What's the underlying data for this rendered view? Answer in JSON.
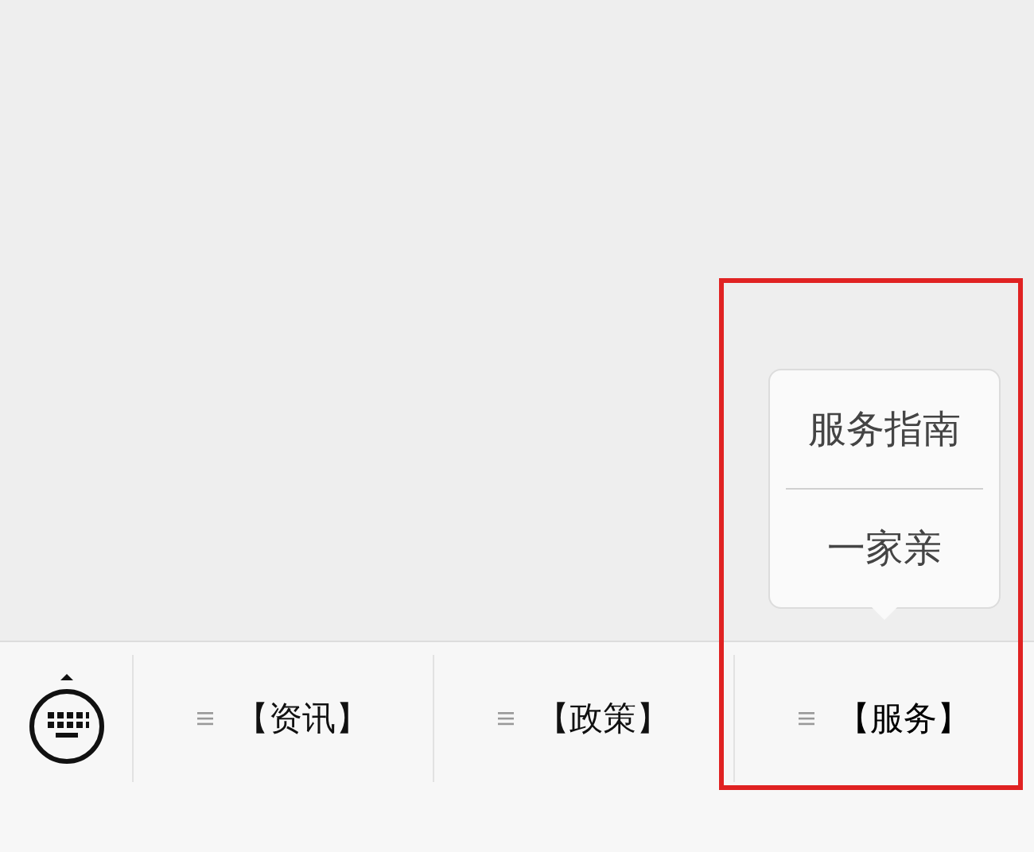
{
  "menus": [
    {
      "label": "【资讯】",
      "expanded": false
    },
    {
      "label": "【政策】",
      "expanded": false
    },
    {
      "label": "【服务】",
      "expanded": true,
      "submenu": [
        {
          "label": "服务指南"
        },
        {
          "label": "一家亲"
        }
      ]
    }
  ],
  "annotation": {
    "kind": "highlight-frame"
  }
}
